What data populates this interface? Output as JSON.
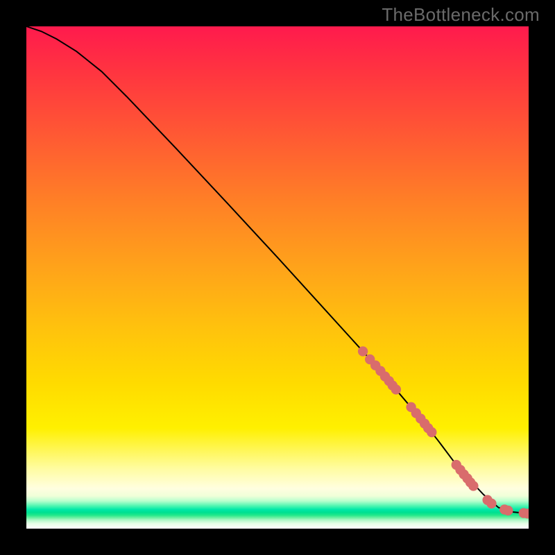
{
  "watermark": "TheBottleneck.com",
  "chart_data": {
    "type": "line",
    "title": "",
    "xlabel": "",
    "ylabel": "",
    "xlim": [
      0,
      100
    ],
    "ylim": [
      0,
      100
    ],
    "grid": false,
    "legend": false,
    "series": [
      {
        "name": "curve",
        "type": "line",
        "x": [
          0,
          3,
          6,
          10,
          15,
          20,
          30,
          40,
          50,
          60,
          68,
          74,
          79,
          82,
          85,
          88,
          91,
          94,
          97,
          100
        ],
        "y": [
          100,
          99,
          97.5,
          95,
          91,
          86,
          75.5,
          64.8,
          54,
          43,
          34.2,
          27.2,
          21.3,
          17.5,
          13.5,
          10,
          6.8,
          4.2,
          3.3,
          3.0
        ]
      },
      {
        "name": "markers",
        "type": "scatter",
        "color": "#d96c6c",
        "x": [
          67.0,
          68.4,
          69.5,
          70.5,
          71.4,
          72.2,
          72.9,
          73.6,
          76.6,
          77.6,
          78.5,
          79.3,
          80.0,
          80.7,
          85.6,
          86.4,
          87.1,
          87.8,
          88.4,
          89.0,
          91.8,
          92.6,
          95.2,
          95.9,
          99.0,
          99.8
        ],
        "y": [
          35.3,
          33.7,
          32.5,
          31.4,
          30.3,
          29.4,
          28.5,
          27.7,
          24.2,
          23.0,
          21.9,
          20.9,
          20.0,
          19.2,
          12.7,
          11.7,
          10.8,
          10.0,
          9.2,
          8.5,
          5.7,
          5.0,
          3.8,
          3.6,
          3.1,
          3.0
        ]
      }
    ]
  }
}
